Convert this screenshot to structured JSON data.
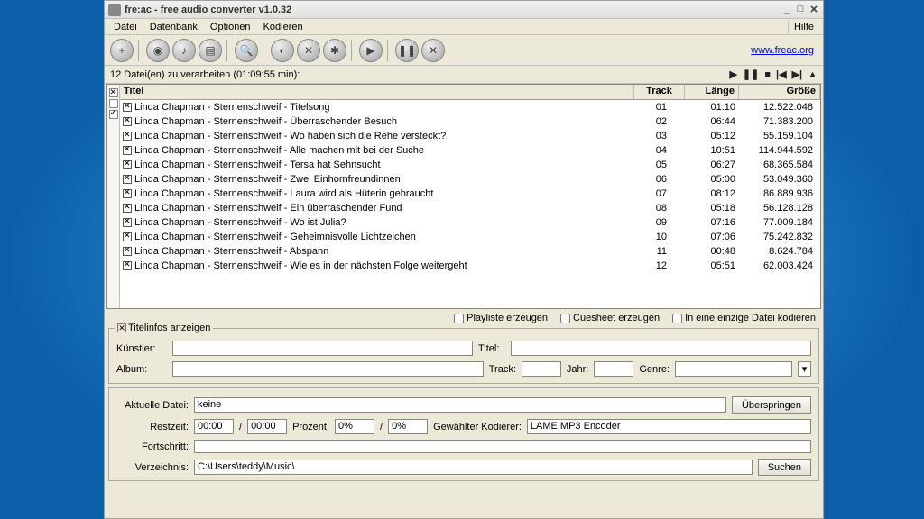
{
  "window": {
    "title": "fre:ac - free audio converter v1.0.32"
  },
  "menu": {
    "datei": "Datei",
    "datenbank": "Datenbank",
    "optionen": "Optionen",
    "kodieren": "Kodieren",
    "hilfe": "Hilfe"
  },
  "link": "www.freac.org",
  "status": "12 Datei(en) zu verarbeiten (01:09:55 min):",
  "columns": {
    "titel": "Titel",
    "track": "Track",
    "lange": "Länge",
    "grobe": "Größe"
  },
  "tracks": [
    {
      "title": "Linda Chapman - Sternenschweif - Titelsong",
      "track": "01",
      "length": "01:10",
      "size": "12.522.048"
    },
    {
      "title": "Linda Chapman - Sternenschweif - Überraschender Besuch",
      "track": "02",
      "length": "06:44",
      "size": "71.383.200"
    },
    {
      "title": "Linda Chapman - Sternenschweif - Wo haben sich die Rehe versteckt?",
      "track": "03",
      "length": "05:12",
      "size": "55.159.104"
    },
    {
      "title": "Linda Chapman - Sternenschweif - Alle machen mit bei der Suche",
      "track": "04",
      "length": "10:51",
      "size": "114.944.592"
    },
    {
      "title": "Linda Chapman - Sternenschweif - Tersa hat Sehnsucht",
      "track": "05",
      "length": "06:27",
      "size": "68.365.584"
    },
    {
      "title": "Linda Chapman - Sternenschweif - Zwei Einhornfreundinnen",
      "track": "06",
      "length": "05:00",
      "size": "53.049.360"
    },
    {
      "title": "Linda Chapman - Sternenschweif - Laura wird als Hüterin gebraucht",
      "track": "07",
      "length": "08:12",
      "size": "86.889.936"
    },
    {
      "title": "Linda Chapman - Sternenschweif - Ein überraschender Fund",
      "track": "08",
      "length": "05:18",
      "size": "56.128.128"
    },
    {
      "title": "Linda Chapman - Sternenschweif - Wo ist Julia?",
      "track": "09",
      "length": "07:16",
      "size": "77.009.184"
    },
    {
      "title": "Linda Chapman - Sternenschweif - Geheimnisvolle Lichtzeichen",
      "track": "10",
      "length": "07:06",
      "size": "75.242.832"
    },
    {
      "title": "Linda Chapman - Sternenschweif - Abspann",
      "track": "11",
      "length": "00:48",
      "size": "8.624.784"
    },
    {
      "title": "Linda Chapman - Sternenschweif - Wie es in der nächsten Folge weitergeht",
      "track": "12",
      "length": "05:51",
      "size": "62.003.424"
    }
  ],
  "opts": {
    "playliste": "Playliste erzeugen",
    "cuesheet": "Cuesheet erzeugen",
    "single": "In eine einzige Datei kodieren"
  },
  "info": {
    "legend": "Titelinfos anzeigen",
    "kunstler": "Künstler:",
    "titel": "Titel:",
    "album": "Album:",
    "track": "Track:",
    "jahr": "Jahr:",
    "genre": "Genre:"
  },
  "bottom": {
    "aktuelle": "Aktuelle Datei:",
    "keine": "keine",
    "uberspringen": "Überspringen",
    "restzeit": "Restzeit:",
    "zeit1": "00:00",
    "zeitsep": " / ",
    "zeit2": "00:00",
    "prozent": "Prozent:",
    "p1": "0%",
    "psep": " / ",
    "p2": "0%",
    "gewahlter": "Gewählter Kodierer:",
    "encoder": "LAME MP3 Encoder",
    "fortschritt": "Fortschritt:",
    "verzeichnis": "Verzeichnis:",
    "path": "C:\\Users\\teddy\\Music\\",
    "suchen": "Suchen"
  }
}
